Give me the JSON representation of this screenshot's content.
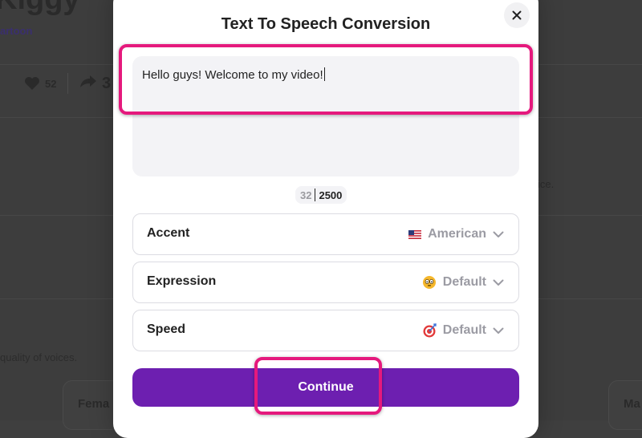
{
  "background": {
    "title_fragment": "Kiggy",
    "category": "artoon",
    "likes": "52",
    "share_count": "3",
    "voice_text": "ice.",
    "quality_text": "quality of voices.",
    "cards": [
      "Fema",
      "Ma"
    ]
  },
  "modal": {
    "title": "Text To Speech Conversion",
    "close_icon": "close-icon",
    "text_input": {
      "value": "Hello guys! Welcome to my video!",
      "char_count": "32",
      "char_limit": "2500"
    },
    "options": [
      {
        "label": "Accent",
        "value": "American",
        "icon": "us-flag-icon"
      },
      {
        "label": "Expression",
        "value": "Default",
        "icon": "emoji-face-icon"
      },
      {
        "label": "Speed",
        "value": "Default",
        "icon": "target-icon"
      }
    ],
    "continue_label": "Continue"
  },
  "colors": {
    "accent": "#6d1fb0",
    "highlight": "#e5197d",
    "backdrop": "#3d3d3d"
  }
}
